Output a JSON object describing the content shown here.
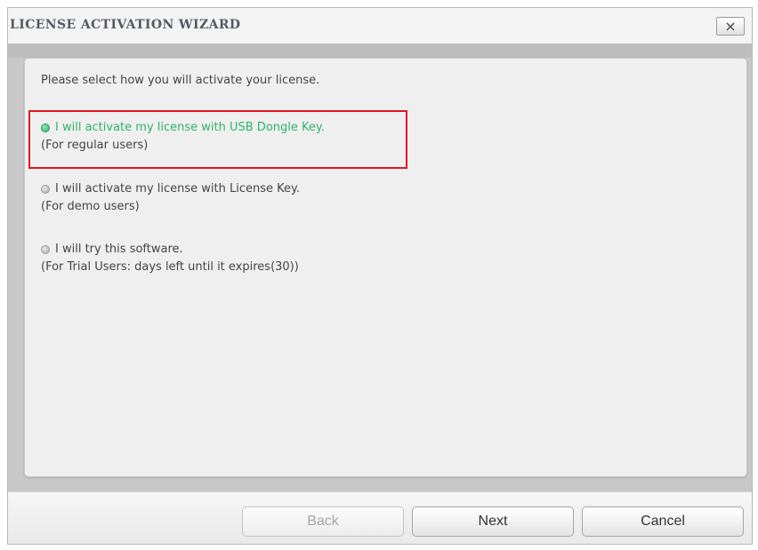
{
  "window": {
    "title": "LICENSE ACTIVATION WIZARD"
  },
  "content": {
    "instruction": "Please select how you will activate your license.",
    "options": [
      {
        "label": "I will activate my license with USB Dongle Key.",
        "sublabel": "(For regular users)",
        "selected": true
      },
      {
        "label": "I will activate my license with License Key.",
        "sublabel": "(For demo users)",
        "selected": false
      },
      {
        "label": "I will try this software.",
        "sublabel": "(For Trial Users: days left until it expires(30))",
        "selected": false
      }
    ]
  },
  "buttons": {
    "back": "Back",
    "next": "Next",
    "cancel": "Cancel"
  },
  "icons": {
    "close": "close-icon",
    "radio_selected": "radio-checked-icon",
    "radio_unselected": "radio-unchecked-icon"
  },
  "colors": {
    "selected_text": "#2db36b",
    "highlight_border": "#e0161f"
  }
}
